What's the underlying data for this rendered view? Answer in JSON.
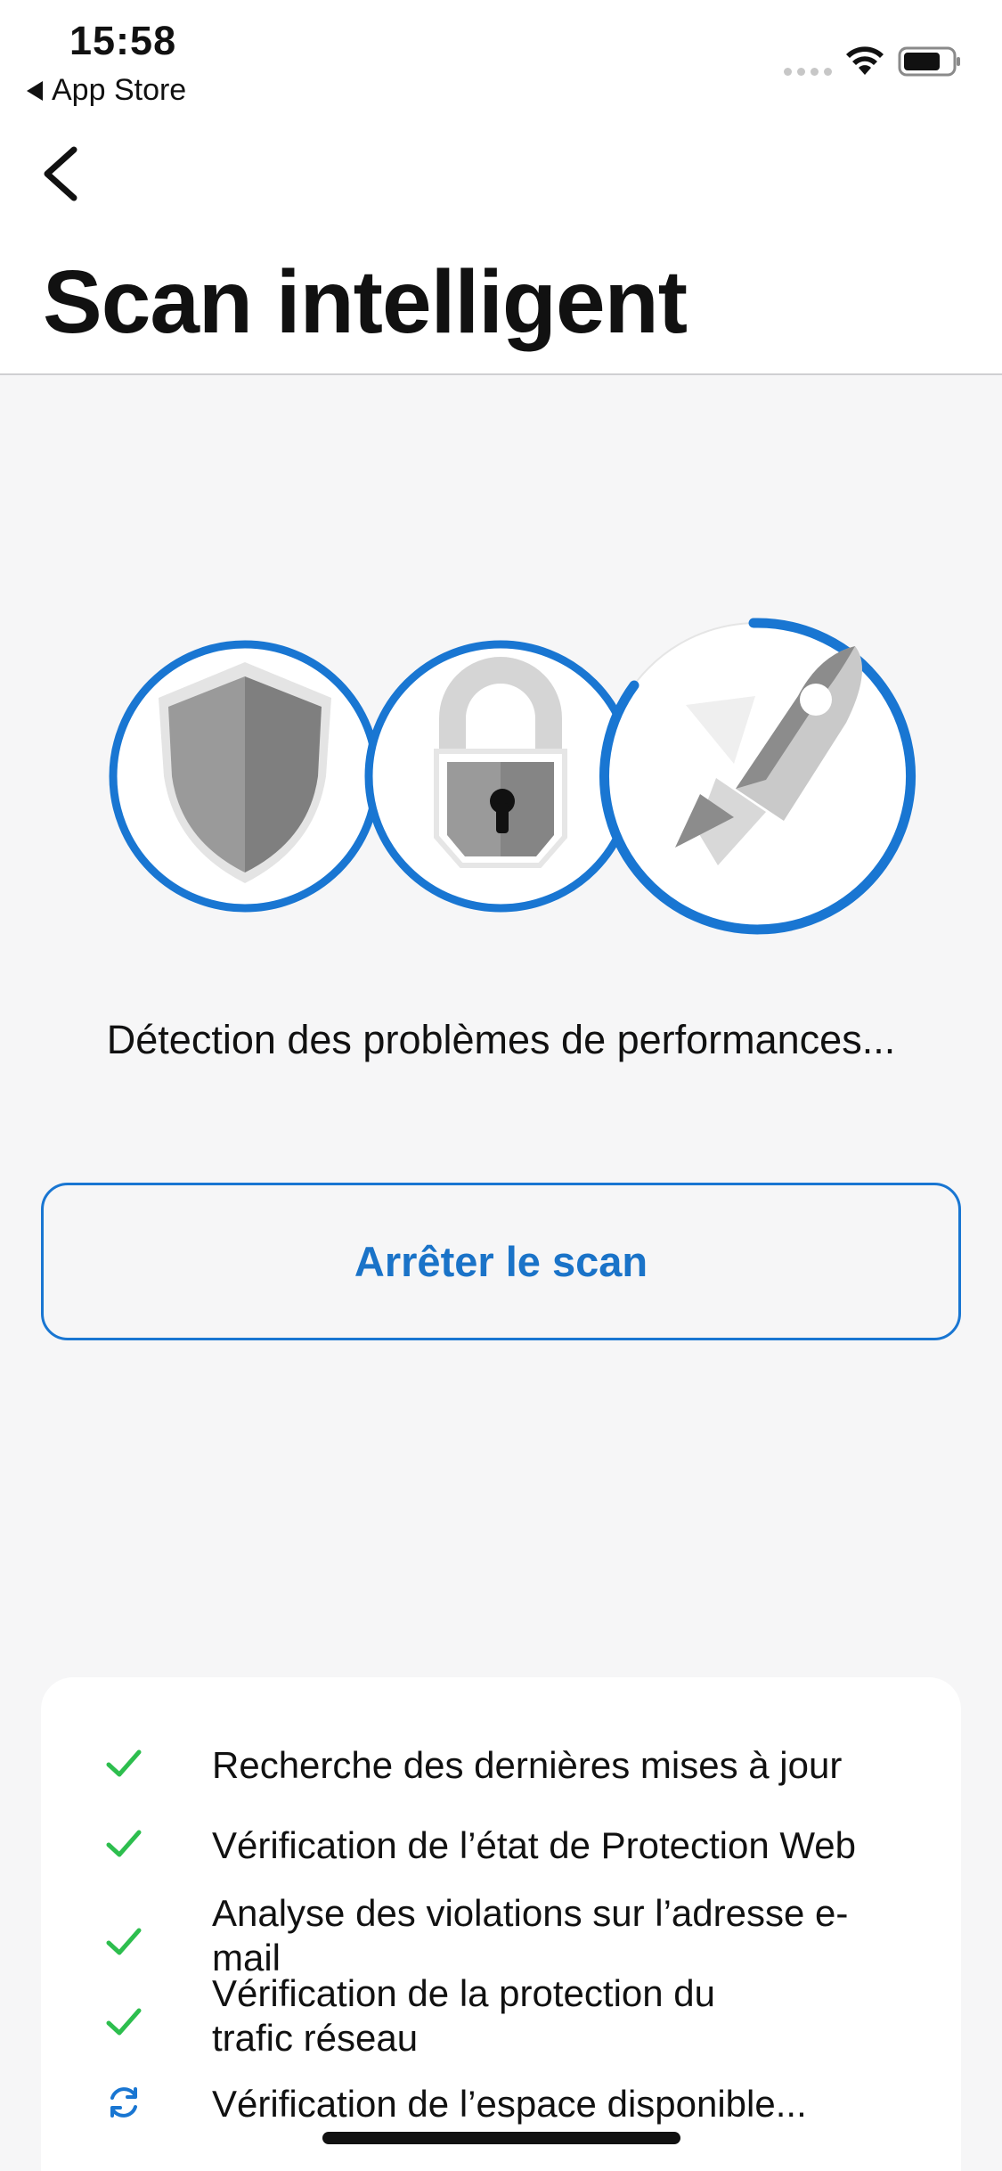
{
  "status_bar": {
    "time": "15:58",
    "back_app": "App Store",
    "icons": [
      "signal-dots-icon",
      "wifi-icon",
      "battery-icon"
    ]
  },
  "header": {
    "back_icon": "chevron-left-icon",
    "title": "Scan intelligent"
  },
  "progress": {
    "steps": [
      {
        "icon": "shield-icon",
        "state": "complete"
      },
      {
        "icon": "lock-icon",
        "state": "complete"
      },
      {
        "icon": "rocket-icon",
        "state": "in-progress",
        "progress": 0.97
      }
    ],
    "message": "Détection des problèmes de performances..."
  },
  "actions": {
    "stop_label": "Arrêter le scan"
  },
  "checklist": {
    "items": [
      {
        "label": "Recherche des dernières mises à jour",
        "status": "done",
        "icon": "checkmark-icon"
      },
      {
        "label": "Vérification de l’état de Protection Web",
        "status": "done",
        "icon": "checkmark-icon"
      },
      {
        "label": "Analyse des violations sur l’adresse e-mail",
        "status": "done",
        "icon": "checkmark-icon"
      },
      {
        "label": "Vérification de la protection du trafic réseau",
        "status": "done",
        "icon": "checkmark-icon"
      },
      {
        "label": "Vérification de l’espace disponible...",
        "status": "loading",
        "icon": "refresh-icon"
      }
    ]
  },
  "colors": {
    "accent": "#1976D2",
    "check": "#2DBE4E",
    "background": "#F6F6F7"
  }
}
